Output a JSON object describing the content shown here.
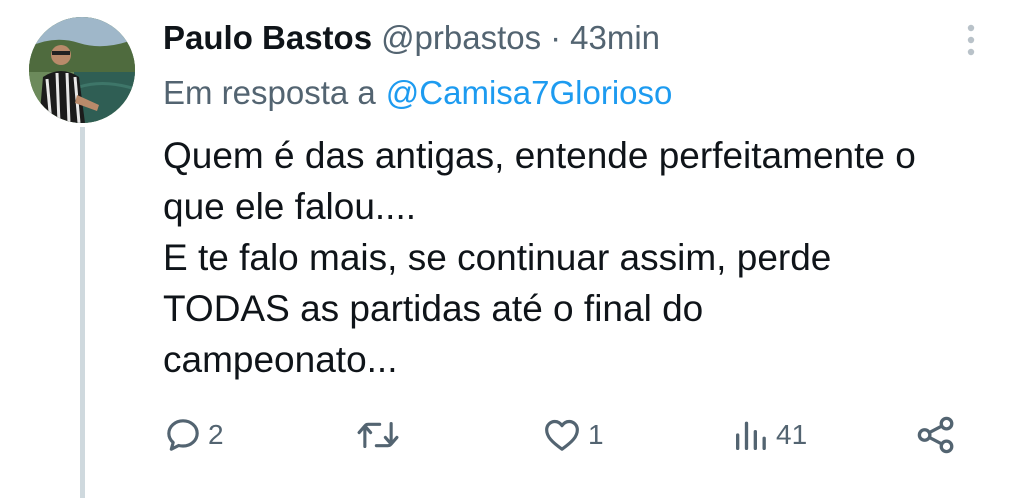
{
  "tweet": {
    "author": {
      "display_name": "Paulo Bastos",
      "handle": "@prbastos",
      "separator": "·",
      "time": "43min"
    },
    "reply_to": {
      "prefix": "Em resposta a",
      "mention": "@Camisa7Glorioso"
    },
    "text_lines": [
      "Quem é das antigas, entende perfeitamente o",
      "que ele falou....",
      "E te falo mais, se continuar assim, perde",
      "TODAS as partidas até o final do",
      "campeonato..."
    ],
    "actions": {
      "reply": {
        "icon": "reply-icon",
        "count": "2"
      },
      "retweet": {
        "icon": "retweet-icon",
        "count": ""
      },
      "like": {
        "icon": "heart-icon",
        "count": "1"
      },
      "views": {
        "icon": "views-icon",
        "count": "41"
      },
      "share": {
        "icon": "share-icon",
        "count": ""
      }
    },
    "colors": {
      "text": "#0f1419",
      "secondary": "#536471",
      "link": "#1d9bf0",
      "thread_line": "#cfd9de"
    }
  }
}
